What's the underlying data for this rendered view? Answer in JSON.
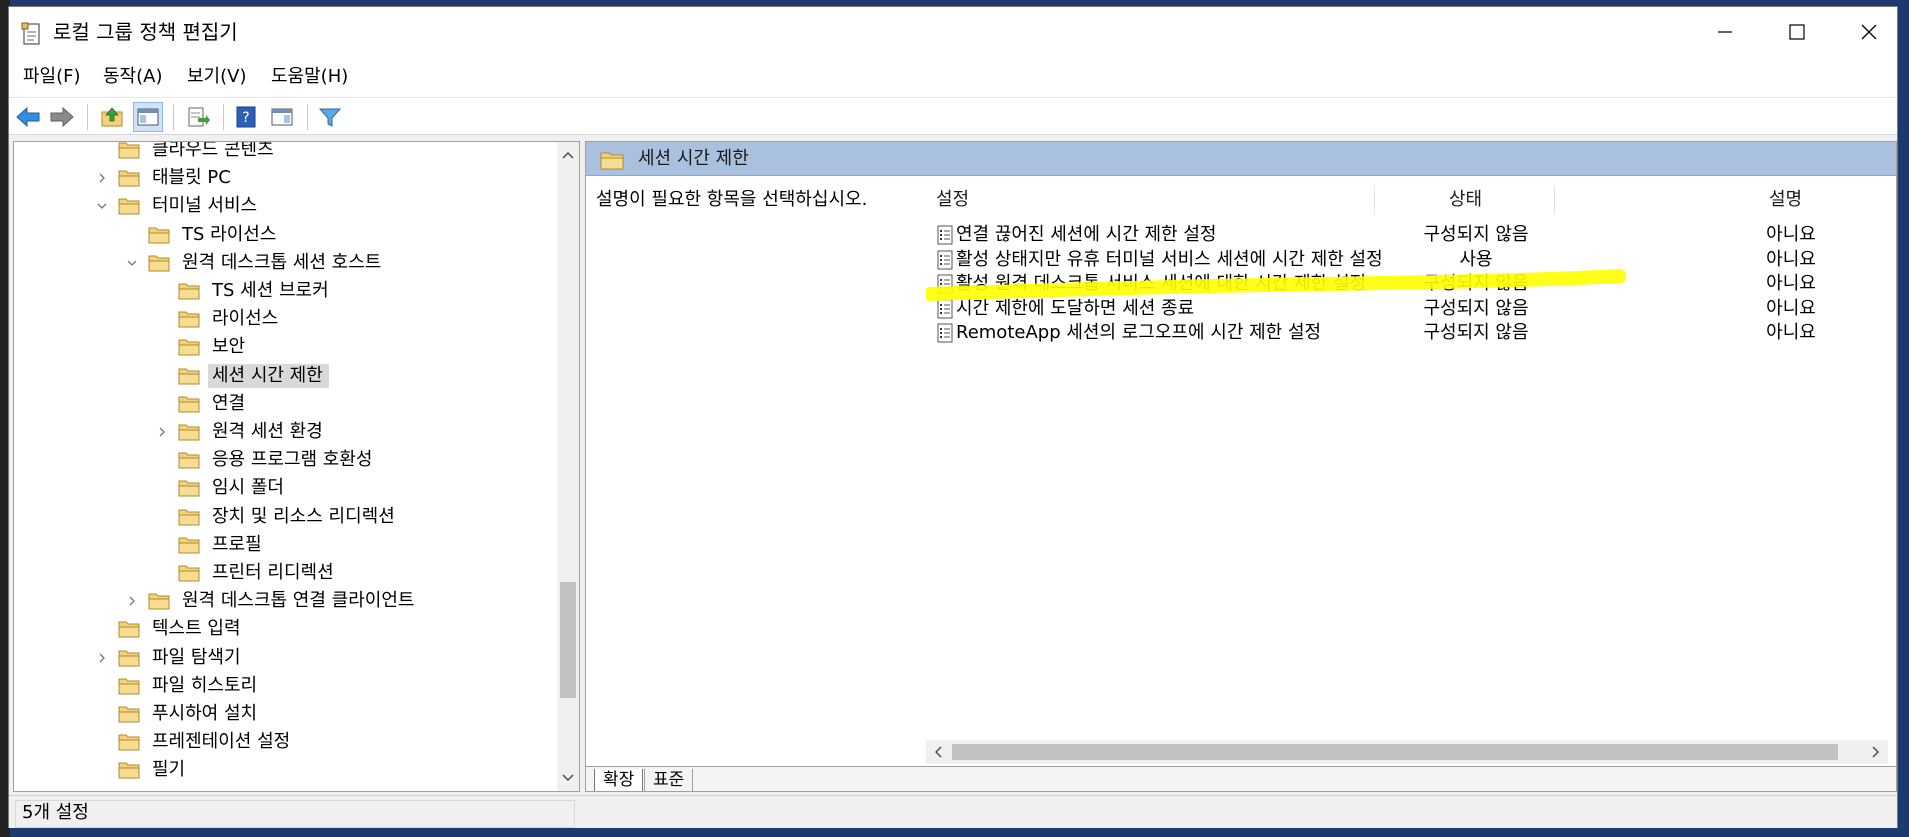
{
  "window": {
    "title": "로컬 그룹 정책 편집기"
  },
  "menu": [
    "파일(F)",
    "동작(A)",
    "보기(V)",
    "도움말(H)"
  ],
  "toolbar": {
    "buttons": [
      "back-arrow-icon",
      "forward-arrow-icon",
      "up-folder-icon",
      "show-hide-tree-icon",
      "export-list-icon",
      "help-icon",
      "show-hide-action-pane-icon",
      "filter-icon"
    ]
  },
  "tree": {
    "items": [
      {
        "label": "클라우드 콘텐츠",
        "level": 1,
        "expander": "none"
      },
      {
        "label": "태블릿 PC",
        "level": 1,
        "expander": "collapsed"
      },
      {
        "label": "터미널 서비스",
        "level": 1,
        "expander": "expanded"
      },
      {
        "label": "TS 라이선스",
        "level": 2,
        "expander": "none"
      },
      {
        "label": "원격 데스크톱 세션 호스트",
        "level": 2,
        "expander": "expanded"
      },
      {
        "label": "TS 세션 브로커",
        "level": 3,
        "expander": "none"
      },
      {
        "label": "라이선스",
        "level": 3,
        "expander": "none"
      },
      {
        "label": "보안",
        "level": 3,
        "expander": "none"
      },
      {
        "label": "세션 시간 제한",
        "level": 3,
        "expander": "none",
        "selected": true
      },
      {
        "label": "연결",
        "level": 3,
        "expander": "none"
      },
      {
        "label": "원격 세션 환경",
        "level": 3,
        "expander": "collapsed"
      },
      {
        "label": "응용 프로그램 호환성",
        "level": 3,
        "expander": "none"
      },
      {
        "label": "임시 폴더",
        "level": 3,
        "expander": "none"
      },
      {
        "label": "장치 및 리소스 리디렉션",
        "level": 3,
        "expander": "none"
      },
      {
        "label": "프로필",
        "level": 3,
        "expander": "none"
      },
      {
        "label": "프린터 리디렉션",
        "level": 3,
        "expander": "none"
      },
      {
        "label": "원격 데스크톱 연결 클라이언트",
        "level": 2,
        "expander": "collapsed"
      },
      {
        "label": "텍스트 입력",
        "level": 1,
        "expander": "none"
      },
      {
        "label": "파일 탐색기",
        "level": 1,
        "expander": "collapsed"
      },
      {
        "label": "파일 히스토리",
        "level": 1,
        "expander": "none"
      },
      {
        "label": "푸시하여 설치",
        "level": 1,
        "expander": "none"
      },
      {
        "label": "프레젠테이션 설정",
        "level": 1,
        "expander": "none"
      },
      {
        "label": "필기",
        "level": 1,
        "expander": "none"
      }
    ]
  },
  "details": {
    "header_title": "세션 시간 제한",
    "description": "설명이 필요한 항목을 선택하십시오.",
    "columns": {
      "setting": "설정",
      "state": "상태",
      "comment": "설명"
    },
    "rows": [
      {
        "name": "연결 끊어진 세션에 시간 제한 설정",
        "state": "구성되지 않음",
        "comment": "아니요"
      },
      {
        "name": "활성 상태지만 유휴 터미널 서비스 세션에 시간 제한 설정",
        "state": "사용",
        "comment": "아니요",
        "highlighted": true
      },
      {
        "name": "활성 원격 데스크톱 서비스 세션에 대한 시간 제한 설정",
        "state": "구성되지 않음",
        "comment": "아니요"
      },
      {
        "name": "시간 제한에 도달하면 세션 종료",
        "state": "구성되지 않음",
        "comment": "아니요"
      },
      {
        "name": "RemoteApp 세션의 로그오프에 시간 제한 설정",
        "state": "구성되지 않음",
        "comment": "아니요"
      }
    ],
    "tabs": [
      "확장",
      "표준"
    ],
    "active_tab": "확장"
  },
  "status": {
    "text": "5개 설정"
  },
  "colors": {
    "header_bg": "#a9c0df",
    "highlight": "#ffff00",
    "folder": "#f3d27a"
  }
}
